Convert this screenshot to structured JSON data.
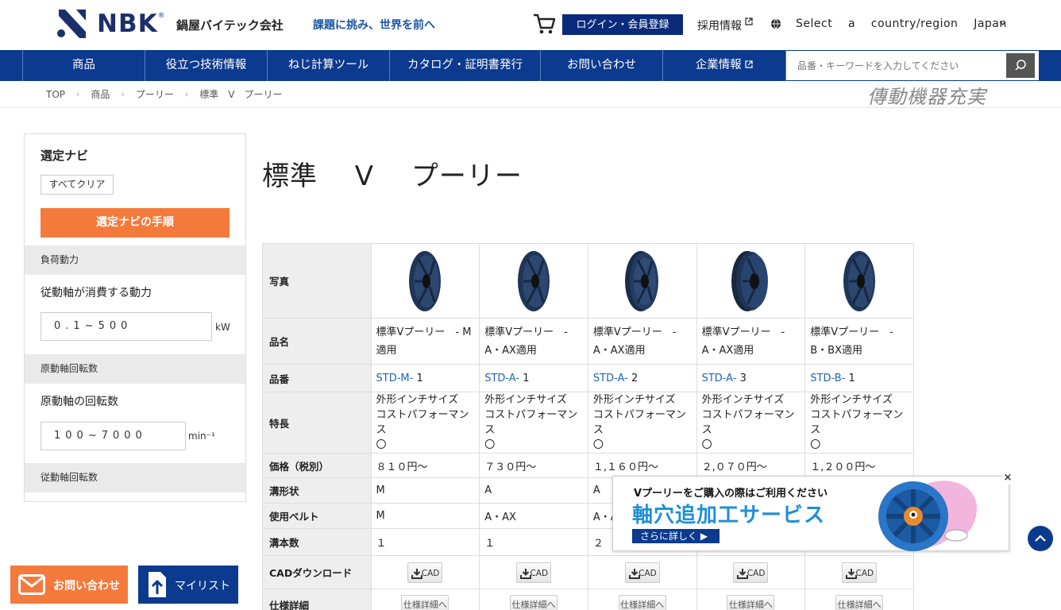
{
  "header": {
    "logo_text": "NBK",
    "logo_reg": "®",
    "company": "鍋屋バイテック会社",
    "slogan": "課題に挑み、世界を前へ",
    "login_label": "ログイン・会員登録",
    "recruit_label": "採用情報",
    "country_label": "Select    a    country/region    Japan"
  },
  "nav": {
    "items": [
      {
        "label": "商品"
      },
      {
        "label": "役立つ技術情報"
      },
      {
        "label": "ねじ計算ツール"
      },
      {
        "label": "カタログ・証明書発行"
      },
      {
        "label": "お問い合わせ"
      },
      {
        "label": "企業情報"
      }
    ],
    "search_placeholder": "品番・キーワードを入力してください"
  },
  "breadcrumb": [
    "TOP",
    "商品",
    "プーリー",
    "標準　V　プーリー"
  ],
  "brush_logo": "傳動機器充実",
  "sidebar": {
    "title": "選定ナビ",
    "clear_label": "すべてクリア",
    "guide_label": "選定ナビの手順",
    "sections": [
      {
        "header": "負荷動力",
        "label": "従動軸が消費する動力",
        "range": "0.1~500",
        "unit": "kW"
      },
      {
        "header": "原動軸回転数",
        "label": "原動軸の回転数",
        "range": "100~7000",
        "unit": "min⁻¹"
      },
      {
        "header": "従動軸回転数"
      }
    ]
  },
  "page_title": "標準　 V　 プーリー",
  "table": {
    "row_headers": {
      "photo": "写真",
      "name": "品名",
      "code": "品番",
      "feature": "特長",
      "price": "価格（税別）",
      "groove": "溝形状",
      "belt": "使用ベルト",
      "count": "溝本数",
      "cad": "CADダウンロード",
      "spec": "仕様詳細"
    },
    "products": [
      {
        "name": "標準Vプーリー　- M適用",
        "code_prefix": "STD-M-",
        "code_num": "1",
        "feature1": "外形インチサイズ",
        "feature2": "コストパフォーマンス",
        "feature3": "〇",
        "price": "８１０円～",
        "groove": "M",
        "belt": "M",
        "count": "１",
        "cad": "CAD",
        "spec": "仕様詳細へ"
      },
      {
        "name": "標準Vプーリー　- A・AX適用",
        "code_prefix": "STD-A-",
        "code_num": "1",
        "feature1": "外形インチサイズ",
        "feature2": "コストパフォーマンス",
        "feature3": "〇",
        "price": "７３０円～",
        "groove": "A",
        "belt": "A・AX",
        "count": "１",
        "cad": "CAD",
        "spec": "仕様詳細へ"
      },
      {
        "name": "標準Vプーリー　- A・AX適用",
        "code_prefix": "STD-A-",
        "code_num": "2",
        "feature1": "外形インチサイズ",
        "feature2": "コストパフォーマンス",
        "feature3": "〇",
        "price": "１,１６０円～",
        "groove": "A",
        "belt": "A・A",
        "count": "２",
        "cad": "CAD",
        "spec": "仕様詳細へ"
      },
      {
        "name": "標準Vプーリー　- A・AX適用",
        "code_prefix": "STD-A-",
        "code_num": "3",
        "feature1": "外形インチサイズ",
        "feature2": "コストパフォーマンス",
        "feature3": "〇",
        "price": "２,０７０円～",
        "groove": "",
        "belt": "",
        "count": "",
        "cad": "CAD",
        "spec": "仕様詳細へ"
      },
      {
        "name": "標準Vプーリー　- B・BX適用",
        "code_prefix": "STD-B-",
        "code_num": "1",
        "feature1": "外形インチサイズ",
        "feature2": "コストパフォーマンス",
        "feature3": "〇",
        "price": "１,２００円～",
        "groove": "",
        "belt": "",
        "count": "",
        "cad": "CAD",
        "spec": "仕様詳細へ"
      }
    ]
  },
  "banner": {
    "top_text": "Vプーリーをご購入の際はご利用ください",
    "main_text": "軸穴追加工サービス",
    "more_label": "さらに詳しく ▶",
    "close": "×"
  },
  "footer": {
    "contact_label": "お問い合わせ",
    "mylist_label": "マイリスト"
  },
  "colors": {
    "nav_blue": "#0b3a8e",
    "accent_orange": "#f47a3c",
    "link_blue": "#1e66b3"
  }
}
